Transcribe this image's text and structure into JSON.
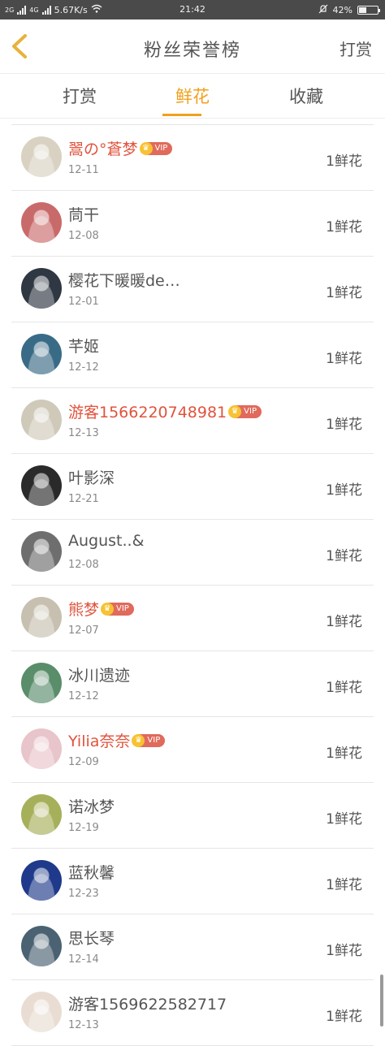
{
  "status_bar": {
    "network_left": "2G",
    "network_right": "4G",
    "speed": "5.67K/s",
    "time": "21:42",
    "battery": "42%",
    "battery_level": 0.42
  },
  "header": {
    "title": "粉丝荣誉榜",
    "action_label": "打赏"
  },
  "tabs": [
    {
      "label": "打赏",
      "active": false
    },
    {
      "label": "鲜花",
      "active": true
    },
    {
      "label": "收藏",
      "active": false
    }
  ],
  "colors": {
    "accent": "#f0a11e",
    "vip_name": "#e0533d",
    "vip_badge": "#e06a5c",
    "crown": "#f7c233"
  },
  "vip_label": "VIP",
  "fans": [
    {
      "name": "翯の°蒼梦",
      "date": "12-11",
      "amount": "1鲜花",
      "vip": true,
      "avatar_color": "#d9d2c2"
    },
    {
      "name": "茼干",
      "date": "12-08",
      "amount": "1鲜花",
      "vip": false,
      "avatar_color": "#c96a6a"
    },
    {
      "name": "樱花下暖暖de…",
      "date": "12-01",
      "amount": "1鲜花",
      "vip": false,
      "avatar_color": "#2e3742"
    },
    {
      "name": "芊姬",
      "date": "12-12",
      "amount": "1鲜花",
      "vip": false,
      "avatar_color": "#3a6b86"
    },
    {
      "name": "游客1566220748981",
      "date": "12-13",
      "amount": "1鲜花",
      "vip": true,
      "avatar_color": "#cfc9b9"
    },
    {
      "name": "叶影深",
      "date": "12-21",
      "amount": "1鲜花",
      "vip": false,
      "avatar_color": "#2a2a2a"
    },
    {
      "name": "August..&",
      "date": "12-08",
      "amount": "1鲜花",
      "vip": false,
      "avatar_color": "#6e6e6e"
    },
    {
      "name": "熊梦",
      "date": "12-07",
      "amount": "1鲜花",
      "vip": true,
      "avatar_color": "#c7c0b0"
    },
    {
      "name": "冰川遗迹",
      "date": "12-12",
      "amount": "1鲜花",
      "vip": false,
      "avatar_color": "#5a8d6a"
    },
    {
      "name": "Yilia奈奈",
      "date": "12-09",
      "amount": "1鲜花",
      "vip": true,
      "avatar_color": "#e8c4cb"
    },
    {
      "name": "诺冰梦",
      "date": "12-19",
      "amount": "1鲜花",
      "vip": false,
      "avatar_color": "#a6b05a"
    },
    {
      "name": "蓝秋馨",
      "date": "12-23",
      "amount": "1鲜花",
      "vip": false,
      "avatar_color": "#1f3a8a"
    },
    {
      "name": "思长琴",
      "date": "12-14",
      "amount": "1鲜花",
      "vip": false,
      "avatar_color": "#4a6272"
    },
    {
      "name": "游客1569622582717",
      "date": "12-13",
      "amount": "1鲜花",
      "vip": false,
      "avatar_color": "#e9ddd3"
    }
  ]
}
